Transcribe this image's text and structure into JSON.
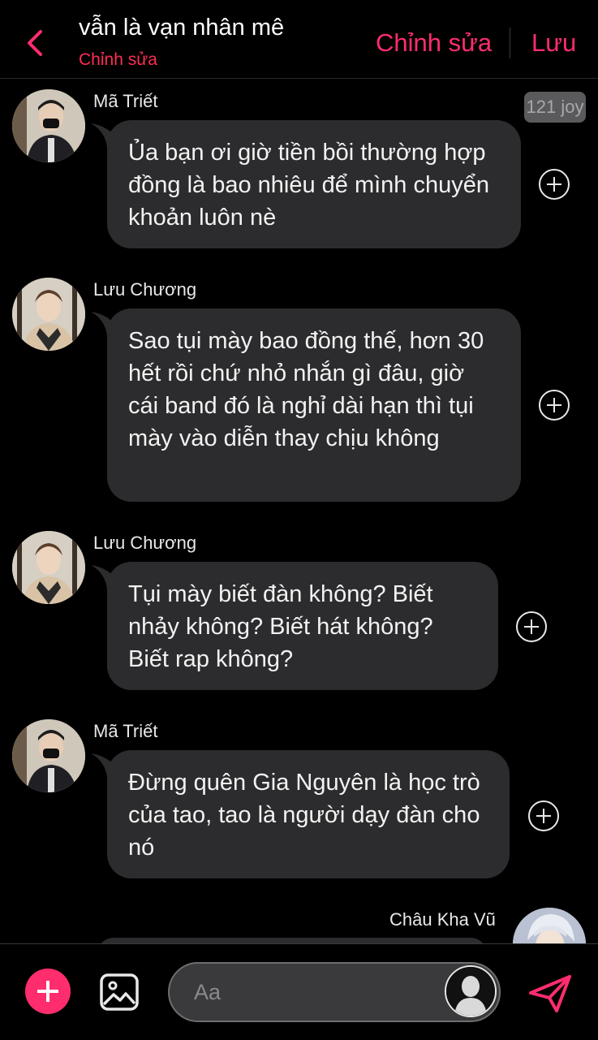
{
  "header": {
    "title": "vẫn là vạn nhân mê",
    "subtitle": "Chỉnh sửa",
    "edit_label": "Chỉnh sửa",
    "save_label": "Lưu",
    "accent_color": "#ff2d6e"
  },
  "badge": {
    "text": "121 joy"
  },
  "messages": [
    {
      "sender": "Mã Triết",
      "text": "Ủa bạn ơi giờ tiền bồi thường hợp đồng là bao nhiêu để mình chuyển khoản luôn nè",
      "avatar_icon": "avatar-ma-triet"
    },
    {
      "sender": "Lưu Chương",
      "text": "Sao tụi mày bao đồng thế, hơn 30 hết rồi chứ nhỏ nhắn gì đâu, giờ cái band đó là nghỉ dài hạn thì tụi mày vào diễn thay chịu không",
      "avatar_icon": "avatar-luu-chuong"
    },
    {
      "sender": "Lưu Chương",
      "text": "Tụi mày biết đàn không? Biết nhảy không? Biết hát không? Biết rap không?",
      "avatar_icon": "avatar-luu-chuong"
    },
    {
      "sender": "Mã Triết",
      "text": "Đừng quên Gia Nguyên là học trò của tao, tao là người dạy đàn cho nó",
      "avatar_icon": "avatar-ma-triet"
    },
    {
      "sender": "Châu Kha Vũ",
      "text": "",
      "avatar_icon": "avatar-chau-kha-vu"
    }
  ],
  "input": {
    "placeholder": "Aa"
  }
}
